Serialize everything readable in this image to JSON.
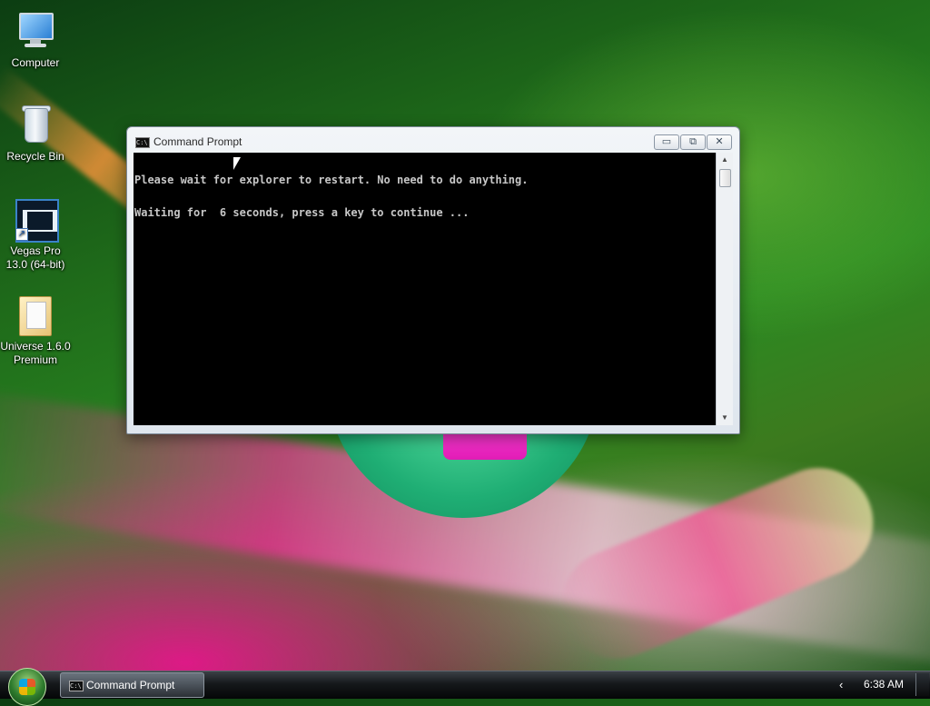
{
  "desktop": {
    "icons": [
      {
        "label": "Computer",
        "icon": "computer-icon"
      },
      {
        "label": "Recycle Bin",
        "icon": "recycle-bin-icon"
      },
      {
        "label": "Vegas Pro\n13.0 (64-bit)",
        "icon": "vegas-pro-icon"
      },
      {
        "label": "Universe 1.6.0\nPremium",
        "icon": "folder-icon"
      }
    ]
  },
  "window": {
    "title": "Command Prompt",
    "icon_text": "C:\\",
    "minimize_symbol": "▭",
    "maximize_symbol": "⧉",
    "close_symbol": "✕",
    "console_lines": [
      "Please wait for explorer to restart. No need to do anything.",
      "Waiting for  6 seconds, press a key to continue ..."
    ],
    "scroll_up": "▲",
    "scroll_down": "▼"
  },
  "taskbar": {
    "task_button_label": "Command Prompt",
    "task_icon_text": "C:\\",
    "tray_chevron": "‹",
    "clock": "6:38 AM"
  }
}
